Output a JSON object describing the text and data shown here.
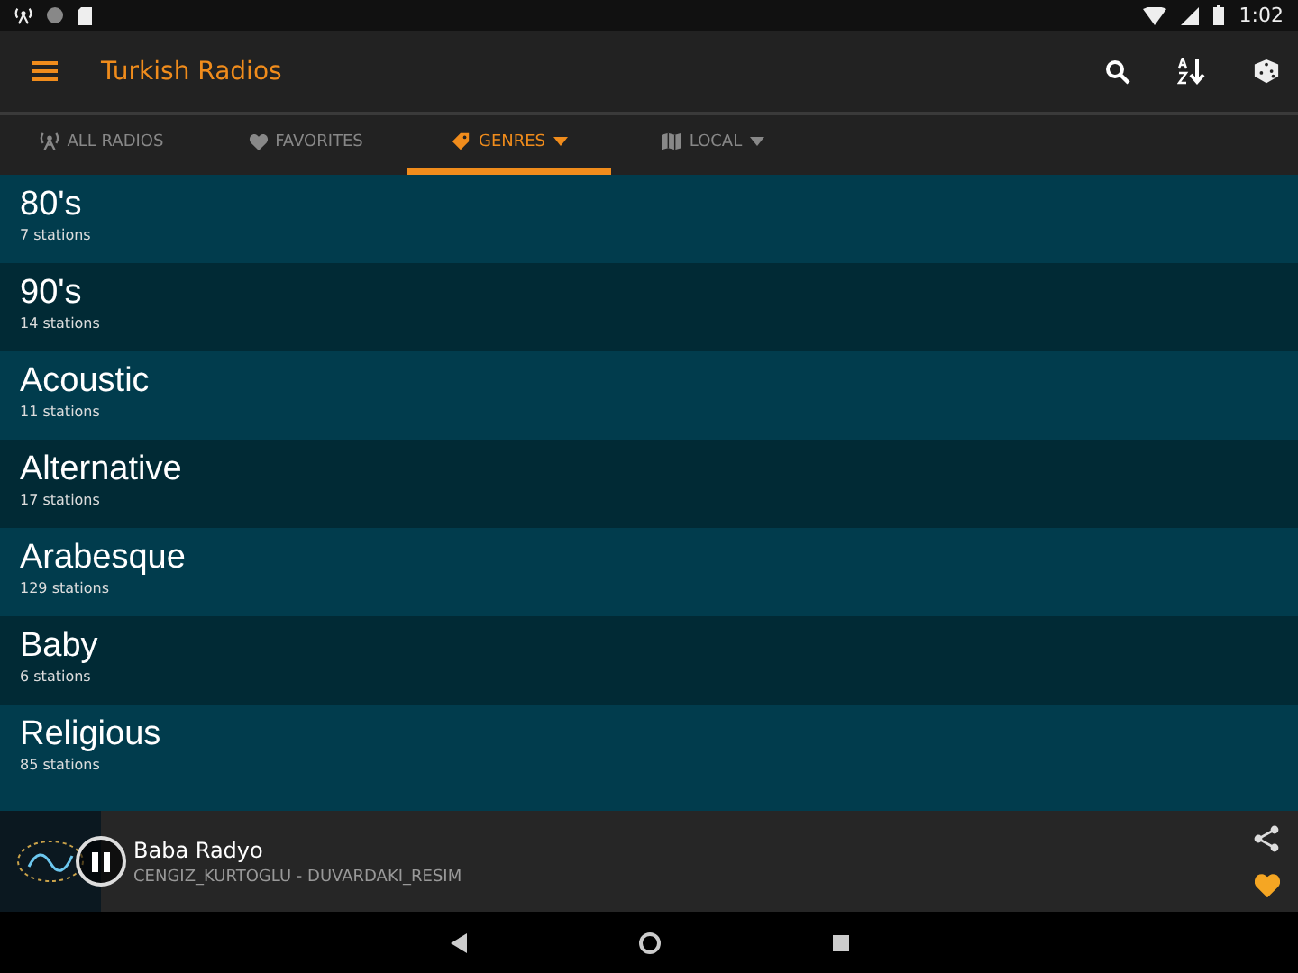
{
  "status_bar": {
    "time": "1:02"
  },
  "app_bar": {
    "title": "Turkish Radios"
  },
  "tabs": [
    {
      "label": "ALL RADIOS",
      "kind": "plain",
      "selected": false
    },
    {
      "label": "FAVORITES",
      "kind": "plain",
      "selected": false
    },
    {
      "label": "GENRES",
      "kind": "dropdown",
      "selected": true
    },
    {
      "label": "LOCAL",
      "kind": "dropdown",
      "selected": false
    }
  ],
  "genres": [
    {
      "name": "80's",
      "count": "7 stations"
    },
    {
      "name": "90's",
      "count": "14 stations"
    },
    {
      "name": "Acoustic",
      "count": "11 stations"
    },
    {
      "name": "Alternative",
      "count": "17 stations"
    },
    {
      "name": "Arabesque",
      "count": "129 stations"
    },
    {
      "name": "Baby",
      "count": "6 stations"
    },
    {
      "name": "Religious",
      "count": "85 stations"
    }
  ],
  "player": {
    "station": "Baba Radyo",
    "track": "CENGIZ_KURTOGLU - DUVARDAKI_RESIM",
    "playing": true,
    "favorite": true
  }
}
